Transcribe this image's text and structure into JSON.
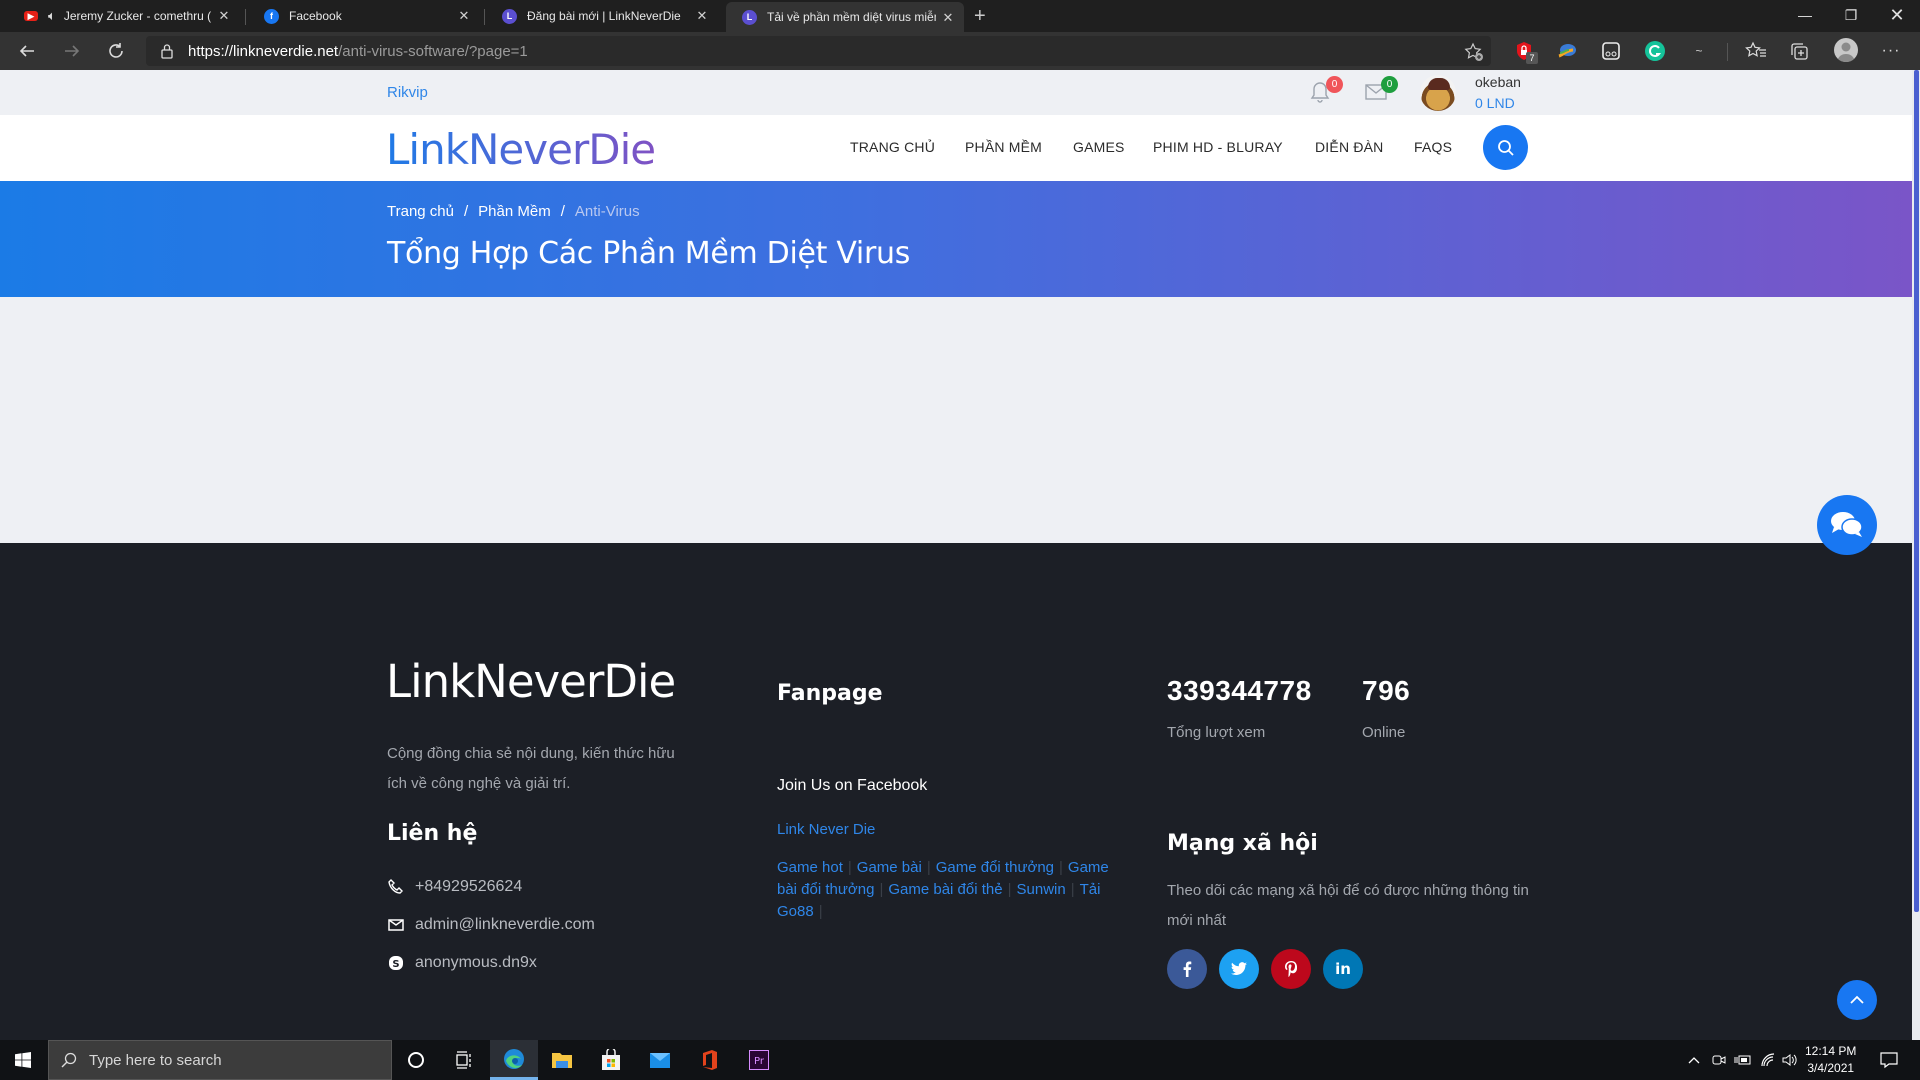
{
  "browser": {
    "tabs": [
      {
        "title": "Jeremy Zucker - comethru (",
        "favicon": "youtube-icon",
        "audio": true
      },
      {
        "title": "Facebook",
        "favicon": "facebook-icon"
      },
      {
        "title": "Đăng bài mới | LinkNeverDie",
        "favicon": "linkneverdie-icon"
      },
      {
        "title": "Tải về phần mềm diệt virus miễn",
        "favicon": "linkneverdie-icon",
        "active": true
      }
    ],
    "new_tab_label": "+",
    "url_host": "https://linkneverdie.net",
    "url_path": "/anti-virus-software/?page=1",
    "extension_badge": "7"
  },
  "topbar": {
    "link": "Rikvip",
    "notifications_count": "0",
    "messages_count": "0",
    "username": "okeban",
    "balance": "0 LND"
  },
  "header": {
    "logo": "LinkNeverDie",
    "menu": [
      "TRANG CHỦ",
      "PHẦN MỀM",
      "GAMES",
      "PHIM HD - BLURAY",
      "DIỄN ĐÀN",
      "FAQS"
    ]
  },
  "hero": {
    "breadcrumb": [
      "Trang chủ",
      "Phần Mềm",
      "Anti-Virus"
    ],
    "breadcrumb_sep": "/",
    "title": "Tổng Hợp Các Phần Mềm Diệt Virus"
  },
  "footer": {
    "logo": "LinkNeverDie",
    "description": "Cộng đồng chia sẻ nội dung, kiến thức hữu ích về công nghệ và giải trí.",
    "contact_heading": "Liên hệ",
    "contacts": [
      {
        "icon": "phone-icon",
        "value": "+84929526624"
      },
      {
        "icon": "envelope-icon",
        "value": "admin@linkneverdie.com"
      },
      {
        "icon": "skype-icon",
        "value": "anonymous.dn9x"
      }
    ],
    "fanpage_heading": "Fanpage",
    "fanpage_join": "Join Us on Facebook",
    "fanpage_link": "Link Never Die",
    "tag_links": [
      "Game hot",
      "Game bài",
      "Game đổi thưởng",
      "Game bài đổi thưởng",
      "Game bài đổi thẻ",
      "Sunwin",
      "Tải Go88"
    ],
    "stats": [
      {
        "value": "339344778",
        "label": "Tổng lượt xem"
      },
      {
        "value": "796",
        "label": "Online"
      }
    ],
    "social_heading": "Mạng xã hội",
    "social_desc": "Theo dõi các mạng xã hội để có được những thông tin mới nhất",
    "social": [
      {
        "name": "facebook",
        "glyph": "f",
        "color": "#3b5998"
      },
      {
        "name": "twitter",
        "glyph": "t",
        "color": "#1da1f2"
      },
      {
        "name": "pinterest",
        "glyph": "p",
        "color": "#bd081c"
      },
      {
        "name": "linkedin",
        "glyph": "in",
        "color": "#0077b5"
      }
    ]
  },
  "taskbar": {
    "search_placeholder": "Type here to search",
    "time": "12:14 PM",
    "date": "3/4/2021"
  },
  "colors": {
    "accent": "#1877f2",
    "link": "#2f86e8",
    "footer_bg": "#1c1f26",
    "hero_start": "#1b7be6",
    "hero_end": "#7a55c8"
  }
}
